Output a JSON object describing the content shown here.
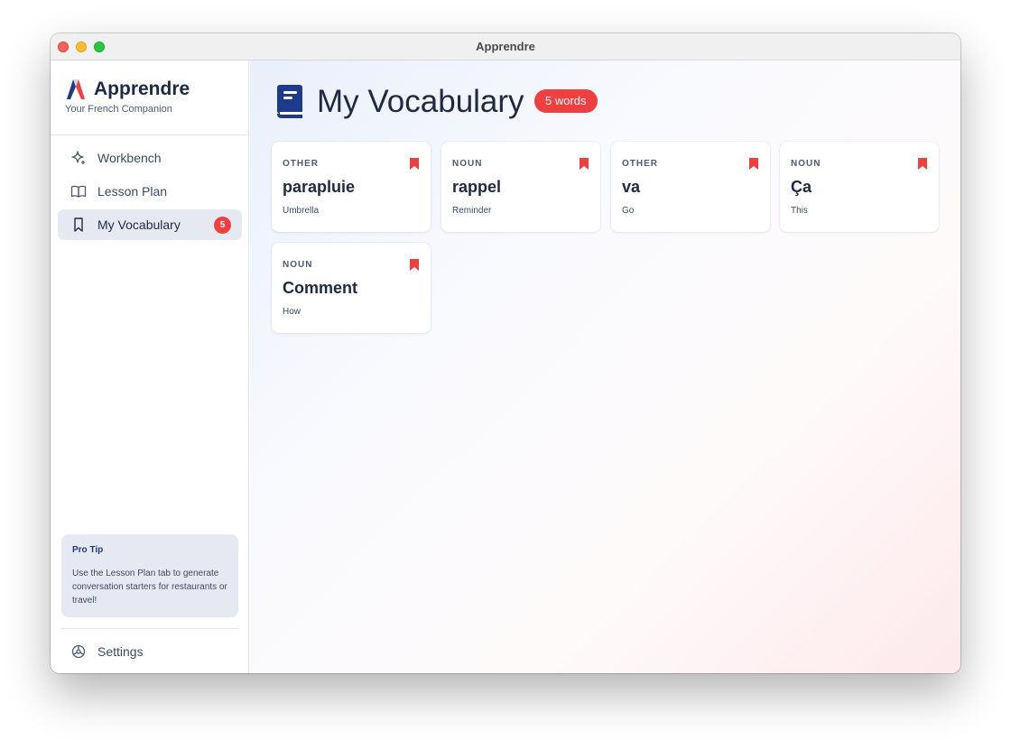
{
  "window": {
    "title": "Apprendre"
  },
  "sidebar": {
    "brand": {
      "name": "Apprendre",
      "subtitle": "Your French Companion"
    },
    "items": [
      {
        "label": "Workbench",
        "icon": "sparkle-icon",
        "active": false
      },
      {
        "label": "Lesson Plan",
        "icon": "book-open-icon",
        "active": false
      },
      {
        "label": "My Vocabulary",
        "icon": "bookmark-icon",
        "active": true,
        "badge": "5"
      }
    ],
    "pro_tip": {
      "title": "Pro Tip",
      "text": "Use the Lesson Plan tab to generate conversation starters for restaurants or travel!"
    },
    "settings_label": "Settings"
  },
  "main": {
    "title": "My Vocabulary",
    "count_badge": "5 words",
    "cards": [
      {
        "pos": "OTHER",
        "word": "parapluie",
        "translation": "Umbrella"
      },
      {
        "pos": "NOUN",
        "word": "rappel",
        "translation": "Reminder"
      },
      {
        "pos": "OTHER",
        "word": "va",
        "translation": "Go"
      },
      {
        "pos": "NOUN",
        "word": "Ça",
        "translation": "This"
      },
      {
        "pos": "NOUN",
        "word": "Comment",
        "translation": "How"
      }
    ]
  },
  "colors": {
    "accent_red": "#ef3f3f",
    "brand_navy": "#1e3a8a",
    "text_dark": "#1e2a44",
    "active_nav_bg": "#e6e9f1"
  }
}
